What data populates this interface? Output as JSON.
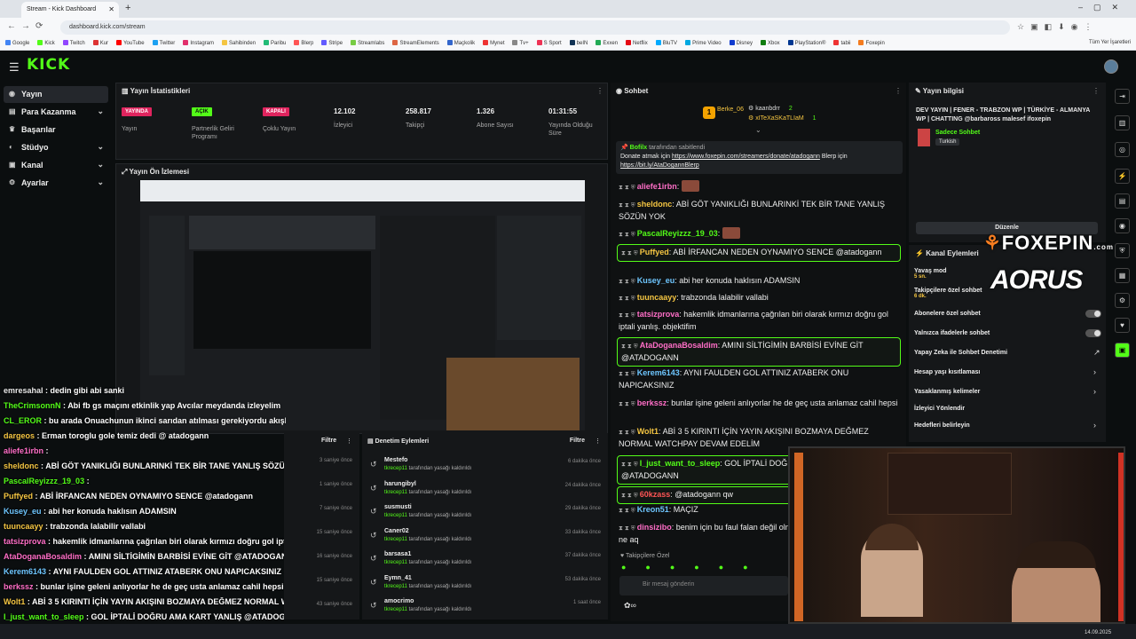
{
  "browser": {
    "tab_title": "Stream - Kick Dashboard",
    "url": "dashboard.kick.com/stream",
    "bookmarks": [
      "Google",
      "Kick",
      "Twitch",
      "Kur",
      "YouTube",
      "Twitter",
      "Instagram",
      "Sahibinden",
      "Paribu",
      "Blerp",
      "Stripe",
      "Streamlabs",
      "StreamElements",
      "Maçkolik",
      "Mynet",
      "Tv+",
      "S Sport",
      "beIN",
      "Exxen",
      "Netflix",
      "BluTV",
      "Prime Video",
      "Disney",
      "Xbox",
      "PlayStation®",
      "tabii",
      "Foxepin"
    ],
    "all_bookmarks": "Tüm Yer İşaretleri"
  },
  "brand": {
    "logo": "KICK",
    "accent": "#53fc18"
  },
  "sidebar": {
    "items": [
      {
        "label": "Yayın",
        "icon": "broadcast-icon"
      },
      {
        "label": "Para Kazanma",
        "icon": "wallet-icon"
      },
      {
        "label": "Başarılar",
        "icon": "trophy-icon"
      },
      {
        "label": "Stüdyo",
        "icon": "studio-icon"
      },
      {
        "label": "Kanal",
        "icon": "channel-icon"
      },
      {
        "label": "Ayarlar",
        "icon": "gear-icon"
      }
    ]
  },
  "stats": {
    "title": "Yayın İstatistikleri",
    "items": [
      {
        "badge": "YAYINDA",
        "label": "Yayın"
      },
      {
        "badge": "AÇIK",
        "label": "Partnerlik Geliri Programı"
      },
      {
        "badge": "KAPALI",
        "label": "Çoklu Yayın"
      },
      {
        "value": "12.102",
        "label": "İzleyici"
      },
      {
        "value": "258.817",
        "label": "Takipçi"
      },
      {
        "value": "1.326",
        "label": "Abone Sayısı"
      },
      {
        "value": "01:31:55",
        "label": "Yayında Olduğu Süre"
      }
    ]
  },
  "preview": {
    "title": "Yayın Ön İzlemesi"
  },
  "overlay_chat": [
    {
      "user": "emresahal",
      "text": "dedin gibi abi sanki",
      "color": "#e8e8e8"
    },
    {
      "user": "TheCrimsonnN",
      "text": "Abi fb gs maçını etkinlik yap Avcılar meydanda izleyelim",
      "color": "#53fc18"
    },
    {
      "user": "CL_EROR",
      "text": "bu arada Onuachunun ikinci sarıdan atılması gerekiyordu akışladı",
      "color": "#53fc18"
    },
    {
      "user": "dargeos",
      "text": "Erman toroglu gole temiz dedi @ atadogann",
      "color": "#f4c542"
    },
    {
      "user": "aliefe1irbn",
      "text": "",
      "color": "#ff6ec7"
    },
    {
      "user": "sheldonc",
      "text": "ABİ GÖT YANIKLIĞI BUNLARINKİ TEK BİR TANE YANLIŞ SÖZÜN YOK",
      "color": "#f4c542"
    },
    {
      "user": "PascalReyizzz_19_03",
      "text": "",
      "color": "#53fc18"
    },
    {
      "user": "Puffyed",
      "text": "ABİ İRFANCAN NEDEN OYNAMIYO SENCE @atadogann",
      "color": "#f4c542"
    },
    {
      "user": "Kusey_eu",
      "text": "abi her konuda haklısın ADAMSIN",
      "color": "#6ec6ff"
    },
    {
      "user": "tuuncaayy",
      "text": "trabzonda lalabilir vallabi",
      "color": "#f4c542"
    },
    {
      "user": "tatsizprova",
      "text": "hakemlik idmanlarına çağrılan biri olarak kırmızı doğru gol iptali",
      "color": "#ff6ec7"
    },
    {
      "user": "AtaDoganaBosaldim",
      "text": "AMINI SİLTİGİMİN BARBİSİ EVİNE GİT @ATADOGANN",
      "color": "#ff6ec7"
    },
    {
      "user": "Kerem6143",
      "text": "AYNI FAULDEN GOL ATTINIZ ATABERK ONU NAPICAKSINIZ",
      "color": "#6ec6ff"
    },
    {
      "user": "berkssz",
      "text": "bunlar işine geleni anlıyorlar he de geç usta anlamaz cahil hepsi",
      "color": "#ff6ec7"
    },
    {
      "user": "Wolt1",
      "text": "ABİ 3 5 KIRINTI İÇİN YAYIN AKIŞINI BOZMAYA DEĞMEZ NORMAL WA",
      "color": "#f4c542"
    },
    {
      "user": "I_just_want_to_sleep",
      "text": "GOL İPTALİ DOĞRU AMA KART YANLIŞ @ATADOG",
      "color": "#53fc18"
    },
    {
      "user": "60kzass",
      "text": "@atadogann qw",
      "color": "#ff5555"
    }
  ],
  "filter": {
    "label": "Filtre",
    "times": [
      "3 saniye önce",
      "1 saniye önce",
      "7 saniye önce",
      "15 saniye önce",
      "16 saniye önce",
      "15 saniye önce",
      "43 saniye önce"
    ]
  },
  "mod_actions": {
    "title": "Denetim Eylemleri",
    "filter": "Filtre",
    "items": [
      {
        "user": "Mestefo",
        "desc": "tarafından yasağı kaldırıldı",
        "by": "tkrecep11",
        "time": "6 dakika önce"
      },
      {
        "user": "harungibyl",
        "desc": "tarafından yasağı kaldırıldı",
        "by": "tkrecep11",
        "time": "24 dakika önce"
      },
      {
        "user": "susmusti",
        "desc": "tarafından yasağı kaldırıldı",
        "by": "tkrecep11",
        "time": "29 dakika önce"
      },
      {
        "user": "Caner02",
        "desc": "tarafından yasağı kaldırıldı",
        "by": "tkrecep11",
        "time": "33 dakika önce"
      },
      {
        "user": "barsasa1",
        "desc": "tarafından yasağı kaldırıldı",
        "by": "tkrecep11",
        "time": "37 dakika önce"
      },
      {
        "user": "Eymn_41",
        "desc": "tarafından yasağı kaldırıldı",
        "by": "tkrecep11",
        "time": "53 dakika önce"
      },
      {
        "user": "amocrimo",
        "desc": "tarafından yasağı kaldırıldı",
        "by": "tkrecep11",
        "time": "1 saat önce"
      }
    ]
  },
  "chat": {
    "title": "Sohbet",
    "top_gifters": [
      {
        "name": "Berke_06",
        "count": ""
      },
      {
        "name": "kaanbdrr",
        "count": "2"
      },
      {
        "name": "xITeXaSKaTLIaM",
        "count": "1"
      }
    ],
    "pinned": {
      "by": "Bofilx",
      "pinned_label": "tarafından sabitlendi",
      "text": "Donate atmak için",
      "link1": "https://www.foxepin.com/streamers/donate/atadogann",
      "mid": "Blerp için",
      "link2": "https://bit.ly/AtaDogannBlerp"
    },
    "messages": [
      {
        "user": "aliefe1irbn",
        "text": "",
        "color": "#ff6ec7",
        "emote": true,
        "hl": false
      },
      {
        "user": "sheldonc",
        "text": "ABİ GÖT YANIKLIĞI BUNLARINKİ TEK BİR TANE YANLIŞ SÖZÜN YOK",
        "color": "#f4c542",
        "hl": false
      },
      {
        "user": "PascalReyizzz_19_03",
        "text": "",
        "color": "#53fc18",
        "emote": true,
        "hl": false
      },
      {
        "user": "Puffyed",
        "text": "ABİ İRFANCAN NEDEN OYNAMIYO SENCE @atadogann",
        "color": "#f4c542",
        "hl": true
      },
      {
        "user": "Kusey_eu",
        "text": "abi her konuda haklısın ADAMSIN",
        "color": "#6ec6ff",
        "hl": false
      },
      {
        "user": "tuuncaayy",
        "text": "trabzonda lalabilir vallabi",
        "color": "#f4c542",
        "hl": false
      },
      {
        "user": "tatsizprova",
        "text": "hakemlik idmanlarına çağrılan biri olarak kırmızı doğru gol iptali yanlış. objektifim",
        "color": "#ff6ec7",
        "hl": false
      },
      {
        "user": "AtaDoganaBosaldim",
        "text": "AMINI SİLTİGİMİN BARBİSİ EVİNE GİT @ATADOGANN",
        "color": "#ff6ec7",
        "hl": true
      },
      {
        "user": "Kerem6143",
        "text": "AYNI FAULDEN GOL ATTINIZ ATABERK ONU NAPICAKSINIZ",
        "color": "#6ec6ff",
        "hl": false
      },
      {
        "user": "berkssz",
        "text": "bunlar işine geleni anlıyorlar he de geç usta anlamaz cahil hepsi",
        "color": "#ff6ec7",
        "hl": false
      },
      {
        "user": "Wolt1",
        "text": "ABİ 3 5 KIRINTI İÇİN YAYIN AKIŞINI BOZMAYA DEĞMEZ NORMAL WATCHPAY DEVAM EDELİM",
        "color": "#f4c542",
        "hl": false
      },
      {
        "user": "I_just_want_to_sleep",
        "text": "GOL İPTALİ DOĞRU AMA KART YANLIŞ @ATADOGANN",
        "color": "#53fc18",
        "hl": true
      },
      {
        "user": "60kzass",
        "text": "@atadogann qw",
        "color": "#ff5555",
        "hl": true
      },
      {
        "user": "Kreon51",
        "text": "MAÇIZ",
        "color": "#6ec6ff",
        "hl": false
      },
      {
        "user": "dinsizibo",
        "text": "benim için bu faul falan değil olmamalı kimseye yapılmamalı bu ne aq",
        "color": "#ff6ec7",
        "hl": false
      }
    ],
    "followers_only": "Takipçilere Özel",
    "input_placeholder": "Bir mesaj gönderin"
  },
  "stream_info": {
    "title": "Yayın bilgisi",
    "stream_title": "DEV YAYIN | FENER - TRABZON WP | TÜRKİYE - ALMANYA WP | CHATTING @barbaross malesef ifoxepin",
    "category": "Sadece Sohbet",
    "tag": "Turkish",
    "edit": "Düzenle"
  },
  "channel_actions": {
    "title": "Kanal Eylemleri",
    "rows": [
      {
        "label": "Yavaş mod",
        "sub": "5 sn."
      },
      {
        "label": "Takipçilere özel sohbet",
        "sub": "6 dk."
      },
      {
        "label": "Abonelere özel sohbet"
      },
      {
        "label": "Yalnızca ifadelerle sohbet"
      },
      {
        "label": "Yapay Zeka ile Sohbet Denetimi"
      },
      {
        "label": "Hesap yaşı kısıtlaması"
      },
      {
        "label": "Yasaklanmış kelimeler"
      },
      {
        "label": "İzleyici Yönlendir"
      },
      {
        "label": "Hedefleri belirleyin"
      }
    ]
  },
  "overlay_logos": {
    "foxepin": "FOXEPIN",
    "foxepin_tld": ".com",
    "aorus": "AORUS"
  },
  "taskbar": {
    "date": "14.09.2025"
  }
}
